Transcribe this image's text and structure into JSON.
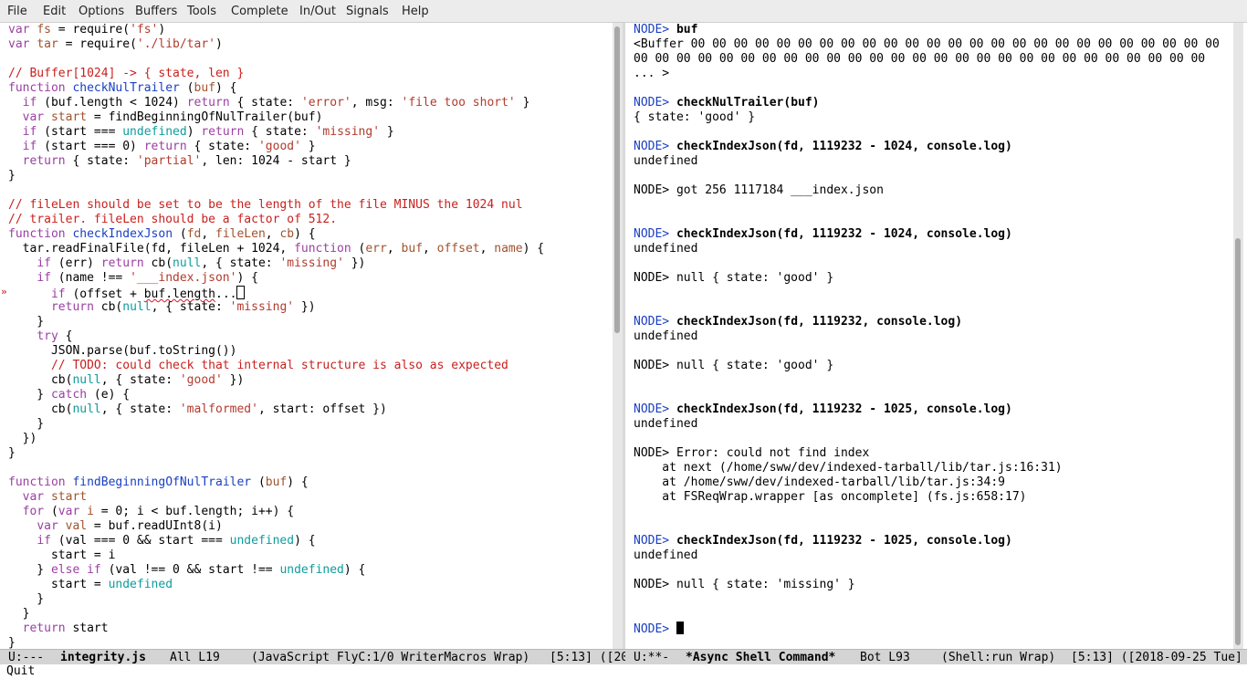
{
  "menu": [
    "File",
    "Edit",
    "Options",
    "Buffers",
    "Tools",
    "Complete",
    "In/Out",
    "Signals",
    "Help"
  ],
  "left_modeline": {
    "status": "U:---",
    "buffer": "integrity.js",
    "position": "All L19",
    "modes": "(JavaScript FlyC:1/0 WriterMacros Wrap)",
    "extra": "[5:13] ([20"
  },
  "right_modeline": {
    "status": "U:**-",
    "buffer": "*Async Shell Command*",
    "position": "Bot L93",
    "modes": "(Shell:run Wrap)",
    "extra": "[5:13] ([2018-09-25 Tue]"
  },
  "echo": "Quit",
  "colors": {
    "keyword": "#9b3fa3",
    "function_name": "#1a3fc3",
    "string": "#b23b2e",
    "variable": "#a0522d",
    "comment": "#c8211e",
    "builtin": "#0f9c9c",
    "prompt": "#1a3fc3",
    "error_marker": "#c01818"
  },
  "icons": {
    "fringe": "flycheck-error-marker-icon"
  },
  "left_code": [
    [
      [
        "var",
        "kw"
      ],
      [
        " "
      ],
      [
        "fs",
        "var"
      ],
      [
        " = require("
      ],
      [
        "'fs'",
        "str"
      ],
      [
        ")"
      ]
    ],
    [
      [
        "var",
        "kw"
      ],
      [
        " "
      ],
      [
        "tar",
        "var"
      ],
      [
        " = require("
      ],
      [
        "'./lib/tar'",
        "str"
      ],
      [
        ")"
      ]
    ],
    [],
    [
      [
        "// Buffer[1024] -> { state, len }",
        "cmt"
      ]
    ],
    [
      [
        "function",
        "kw"
      ],
      [
        " "
      ],
      [
        "checkNulTrailer",
        "fn"
      ],
      [
        " ("
      ],
      [
        "buf",
        "var"
      ],
      [
        ") {"
      ]
    ],
    [
      [
        "  "
      ],
      [
        "if",
        "kw"
      ],
      [
        " (buf.length < 1024) "
      ],
      [
        "return",
        "kw"
      ],
      [
        " { state: "
      ],
      [
        "'error'",
        "str"
      ],
      [
        ", msg: "
      ],
      [
        "'file too short'",
        "str"
      ],
      [
        " }"
      ]
    ],
    [
      [
        "  "
      ],
      [
        "var",
        "kw"
      ],
      [
        " "
      ],
      [
        "start",
        "var"
      ],
      [
        " = findBeginningOfNulTrailer(buf)"
      ]
    ],
    [
      [
        "  "
      ],
      [
        "if",
        "kw"
      ],
      [
        " (start === "
      ],
      [
        "undefined",
        "bi"
      ],
      [
        ") "
      ],
      [
        "return",
        "kw"
      ],
      [
        " { state: "
      ],
      [
        "'missing'",
        "str"
      ],
      [
        " }"
      ]
    ],
    [
      [
        "  "
      ],
      [
        "if",
        "kw"
      ],
      [
        " (start === 0) "
      ],
      [
        "return",
        "kw"
      ],
      [
        " { state: "
      ],
      [
        "'good'",
        "str"
      ],
      [
        " }"
      ]
    ],
    [
      [
        "  "
      ],
      [
        "return",
        "kw"
      ],
      [
        " { state: "
      ],
      [
        "'partial'",
        "str"
      ],
      [
        ", len: 1024 - start }"
      ]
    ],
    [
      [
        "}"
      ]
    ],
    [],
    [
      [
        "// fileLen should be set to be the length of the file MINUS the 1024 nul",
        "cmt"
      ]
    ],
    [
      [
        "// trailer. fileLen should be a factor of 512.",
        "cmt"
      ]
    ],
    [
      [
        "function",
        "kw"
      ],
      [
        " "
      ],
      [
        "checkIndexJson",
        "fn"
      ],
      [
        " ("
      ],
      [
        "fd",
        "var"
      ],
      [
        ", "
      ],
      [
        "fileLen",
        "var"
      ],
      [
        ", "
      ],
      [
        "cb",
        "var"
      ],
      [
        ") {"
      ]
    ],
    [
      [
        "  tar.readFinalFile(fd, fileLen + 1024, "
      ],
      [
        "function",
        "kw"
      ],
      [
        " ("
      ],
      [
        "err",
        "var"
      ],
      [
        ", "
      ],
      [
        "buf",
        "var"
      ],
      [
        ", "
      ],
      [
        "offset",
        "var"
      ],
      [
        ", "
      ],
      [
        "name",
        "var"
      ],
      [
        ") {"
      ]
    ],
    [
      [
        "    "
      ],
      [
        "if",
        "kw"
      ],
      [
        " (err) "
      ],
      [
        "return",
        "kw"
      ],
      [
        " cb("
      ],
      [
        "null",
        "bi"
      ],
      [
        ", { state: "
      ],
      [
        "'missing'",
        "str"
      ],
      [
        " })"
      ]
    ],
    [
      [
        "    "
      ],
      [
        "if",
        "kw"
      ],
      [
        " (name !== "
      ],
      [
        "'___index.json'",
        "str"
      ],
      [
        ") {"
      ]
    ],
    [
      [
        "      "
      ],
      [
        "if",
        "kw"
      ],
      [
        " (offset + "
      ],
      [
        "buf.length",
        "squig"
      ],
      [
        "..."
      ],
      [
        "",
        "cursor"
      ]
    ],
    [
      [
        "      "
      ],
      [
        "return",
        "kw"
      ],
      [
        " cb("
      ],
      [
        "null",
        "bi"
      ],
      [
        ", { state: "
      ],
      [
        "'missing'",
        "str"
      ],
      [
        " })"
      ]
    ],
    [
      [
        "    }"
      ]
    ],
    [
      [
        "    "
      ],
      [
        "try",
        "kw"
      ],
      [
        " {"
      ]
    ],
    [
      [
        "      JSON.parse(buf.toString())"
      ]
    ],
    [
      [
        "      "
      ],
      [
        "// TODO: could check that internal structure is also as expected",
        "cmt"
      ]
    ],
    [
      [
        "      cb("
      ],
      [
        "null",
        "bi"
      ],
      [
        ", { state: "
      ],
      [
        "'good'",
        "str"
      ],
      [
        " })"
      ]
    ],
    [
      [
        "    } "
      ],
      [
        "catch",
        "kw"
      ],
      [
        " (e) {"
      ]
    ],
    [
      [
        "      cb("
      ],
      [
        "null",
        "bi"
      ],
      [
        ", { state: "
      ],
      [
        "'malformed'",
        "str"
      ],
      [
        ", start: offset })"
      ]
    ],
    [
      [
        "    }"
      ]
    ],
    [
      [
        "  })"
      ]
    ],
    [
      [
        "}"
      ]
    ],
    [],
    [
      [
        "function",
        "kw"
      ],
      [
        " "
      ],
      [
        "findBeginningOfNulTrailer",
        "fn"
      ],
      [
        " ("
      ],
      [
        "buf",
        "var"
      ],
      [
        ") {"
      ]
    ],
    [
      [
        "  "
      ],
      [
        "var",
        "kw"
      ],
      [
        " "
      ],
      [
        "start",
        "var"
      ]
    ],
    [
      [
        "  "
      ],
      [
        "for",
        "kw"
      ],
      [
        " ("
      ],
      [
        "var",
        "kw"
      ],
      [
        " "
      ],
      [
        "i",
        "var"
      ],
      [
        " = 0; i < buf.length; i++) {"
      ]
    ],
    [
      [
        "    "
      ],
      [
        "var",
        "kw"
      ],
      [
        " "
      ],
      [
        "val",
        "var"
      ],
      [
        " = buf.readUInt8(i)"
      ]
    ],
    [
      [
        "    "
      ],
      [
        "if",
        "kw"
      ],
      [
        " (val === 0 && start === "
      ],
      [
        "undefined",
        "bi"
      ],
      [
        ") {"
      ]
    ],
    [
      [
        "      start = i"
      ]
    ],
    [
      [
        "    } "
      ],
      [
        "else if",
        "kw"
      ],
      [
        " (val !== 0 && start !== "
      ],
      [
        "undefined",
        "bi"
      ],
      [
        ") {"
      ]
    ],
    [
      [
        "      start = "
      ],
      [
        "undefined",
        "bi"
      ]
    ],
    [
      [
        "    }"
      ]
    ],
    [
      [
        "  }"
      ]
    ],
    [
      [
        "  "
      ],
      [
        "return",
        "kw"
      ],
      [
        " start"
      ]
    ],
    [
      [
        "}"
      ]
    ]
  ],
  "right_shell": [
    [
      [
        "NODE>",
        "pr"
      ],
      [
        " "
      ],
      [
        "buf",
        "cmd"
      ]
    ],
    [
      [
        "<Buffer 00 00 00 00 00 00 00 00 00 00 00 00 00 00 00 00 00 00 00 00 00 00 00 00 00 00 00"
      ]
    ],
    [
      [
        "00 00 00 00 00 00 00 00 00 00 00 00 00 00 00 00 00 00 00 00 00 00 00 00 00 00 00"
      ]
    ],
    [
      [
        "... >"
      ]
    ],
    [],
    [
      [
        "NODE>",
        "pr"
      ],
      [
        " "
      ],
      [
        "checkNulTrailer(buf)",
        "cmd"
      ]
    ],
    [
      [
        "{ state: 'good' }"
      ]
    ],
    [],
    [
      [
        "NODE>",
        "pr"
      ],
      [
        " "
      ],
      [
        "checkIndexJson(fd, 1119232 - 1024, console.log)",
        "cmd"
      ]
    ],
    [
      [
        "undefined"
      ]
    ],
    [],
    [
      [
        "NODE> got 256 1117184 ___index.json"
      ]
    ],
    [],
    [],
    [
      [
        "NODE>",
        "pr"
      ],
      [
        " "
      ],
      [
        "checkIndexJson(fd, 1119232 - 1024, console.log)",
        "cmd"
      ]
    ],
    [
      [
        "undefined"
      ]
    ],
    [],
    [
      [
        "NODE> null { state: 'good' }"
      ]
    ],
    [],
    [],
    [
      [
        "NODE>",
        "pr"
      ],
      [
        " "
      ],
      [
        "checkIndexJson(fd, 1119232, console.log)",
        "cmd"
      ]
    ],
    [
      [
        "undefined"
      ]
    ],
    [],
    [
      [
        "NODE> null { state: 'good' }"
      ]
    ],
    [],
    [],
    [
      [
        "NODE>",
        "pr"
      ],
      [
        " "
      ],
      [
        "checkIndexJson(fd, 1119232 - 1025, console.log)",
        "cmd"
      ]
    ],
    [
      [
        "undefined"
      ]
    ],
    [],
    [
      [
        "NODE> Error: could not find index"
      ]
    ],
    [
      [
        "    at next (/home/sww/dev/indexed-tarball/lib/tar.js:16:31)"
      ]
    ],
    [
      [
        "    at /home/sww/dev/indexed-tarball/lib/tar.js:34:9"
      ]
    ],
    [
      [
        "    at FSReqWrap.wrapper [as oncomplete] (fs.js:658:17)"
      ]
    ],
    [],
    [],
    [
      [
        "NODE>",
        "pr"
      ],
      [
        " "
      ],
      [
        "checkIndexJson(fd, 1119232 - 1025, console.log)",
        "cmd"
      ]
    ],
    [
      [
        "undefined"
      ]
    ],
    [],
    [
      [
        "NODE> null { state: 'missing' }"
      ]
    ],
    [],
    [],
    [
      [
        "NODE>",
        "pr"
      ],
      [
        " "
      ],
      [
        "",
        "cursor-block"
      ]
    ]
  ]
}
